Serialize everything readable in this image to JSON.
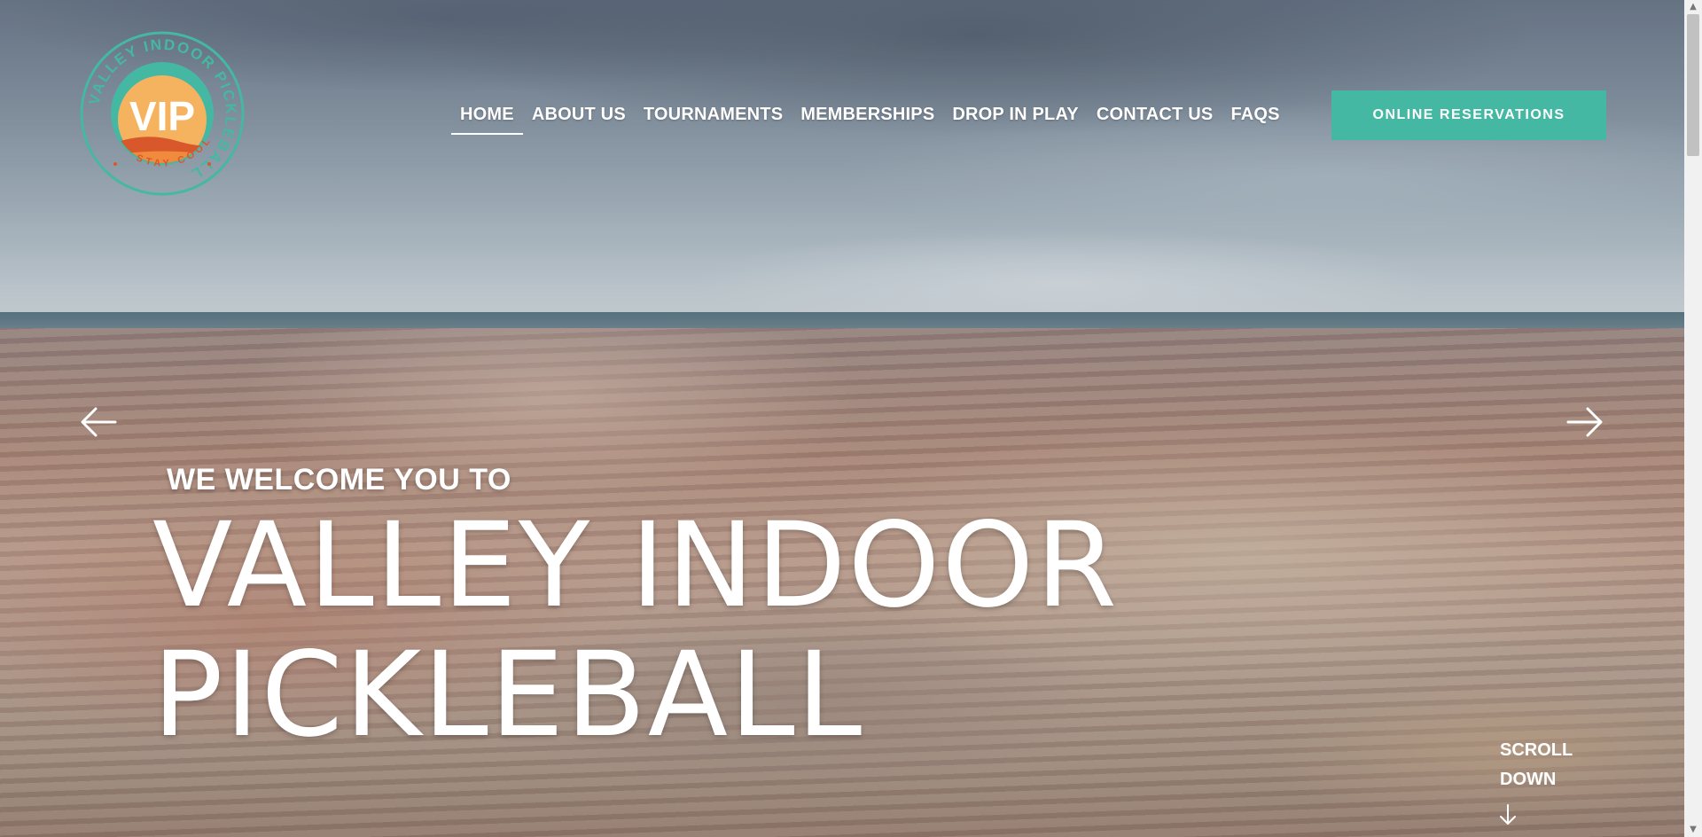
{
  "brand": {
    "logo_ring_text": "VALLEY INDOOR PICKLEBALL",
    "logo_monogram": "VIP",
    "logo_tagline": "STAY COOL",
    "colors": {
      "teal": "#44b8a3",
      "orange": "#f2a04a",
      "sun": "#f6b35f",
      "red": "#d9582b"
    }
  },
  "nav": {
    "items": [
      {
        "label": "HOME",
        "active": true
      },
      {
        "label": "ABOUT US"
      },
      {
        "label": "TOURNAMENTS"
      },
      {
        "label": "MEMBERSHIPS"
      },
      {
        "label": "DROP IN PLAY"
      },
      {
        "label": "CONTACT US"
      },
      {
        "label": "FAQS"
      }
    ],
    "cta_label": "ONLINE RESERVATIONS"
  },
  "hero": {
    "subtitle": "WE WELCOME YOU TO",
    "title_line1": "VALLEY INDOOR",
    "title_line2": "PICKLEBALL",
    "prev_icon": "arrow-left-icon",
    "next_icon": "arrow-right-icon"
  },
  "scroll": {
    "line1": "SCROLL",
    "line2": "DOWN",
    "icon": "arrow-down-icon"
  }
}
